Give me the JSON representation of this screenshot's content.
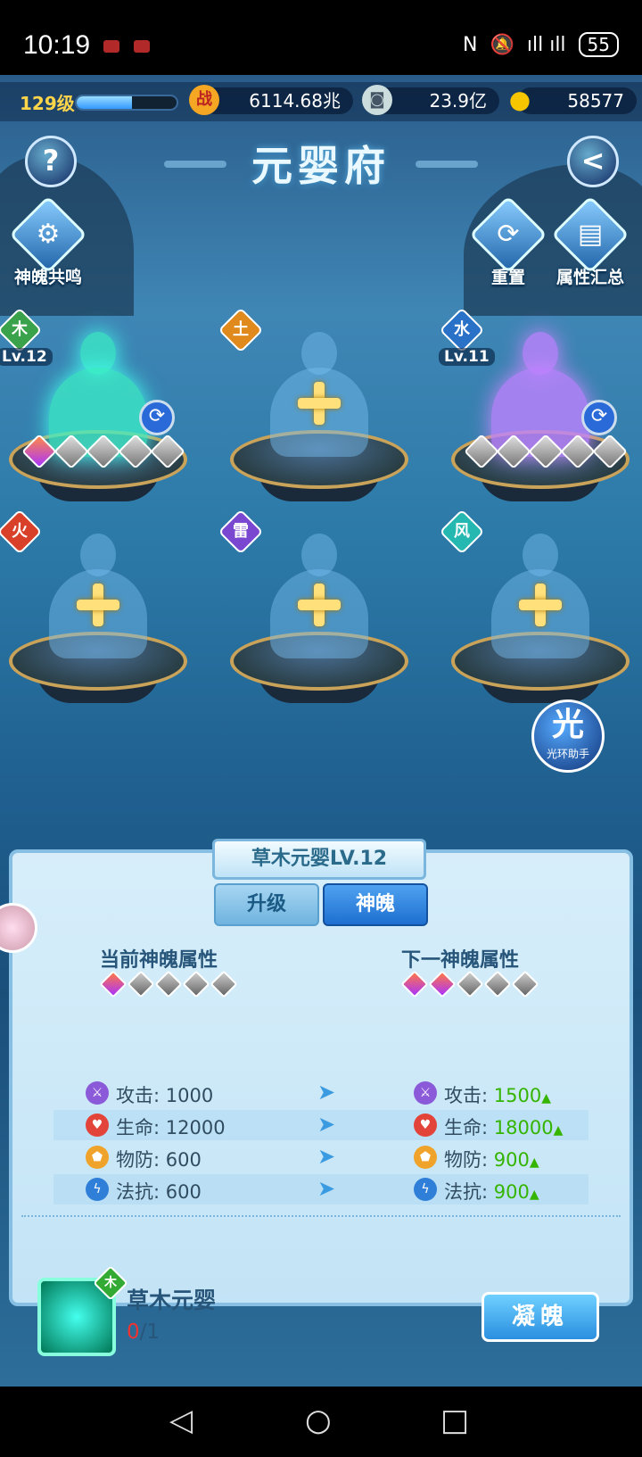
{
  "status": {
    "time": "10:19",
    "signal": "ıll ıll",
    "battery": "55"
  },
  "player": {
    "level": "129级",
    "xp_fraction": 0.55
  },
  "resources": [
    {
      "icon": "战",
      "value": "6114.68兆"
    },
    {
      "icon": "◙",
      "value": "23.9亿"
    },
    {
      "icon": "●",
      "value": "58577"
    }
  ],
  "title": "元婴府",
  "buttons": {
    "help": "?",
    "back": "<",
    "resonance": "神魄共鸣",
    "reset": "重置",
    "summary": "属性汇总"
  },
  "slots": [
    {
      "element": "木",
      "level": "Lv.12",
      "color": "#3aa24a"
    },
    {
      "element": "土",
      "color": "#e08a1e"
    },
    {
      "element": "水",
      "level": "Lv.11",
      "color": "#2a72c8"
    },
    {
      "element": "火",
      "color": "#d8402a"
    },
    {
      "element": "雷",
      "color": "#7a48d0"
    },
    {
      "element": "风",
      "color": "#25b8b0"
    }
  ],
  "assistant": {
    "big": "光",
    "small": "光环助手"
  },
  "panel": {
    "title": "草木元婴LV.12",
    "tabs": [
      "升级",
      "神魄"
    ],
    "current_header": "当前神魄属性",
    "next_header": "下一神魄属性",
    "stats": [
      {
        "name": "攻击: ",
        "current": "1000",
        "next": "1500"
      },
      {
        "name": "生命: ",
        "current": "12000",
        "next": "18000"
      },
      {
        "name": "物防: ",
        "current": "600",
        "next": "900"
      },
      {
        "name": "法抗: ",
        "current": "600",
        "next": "900"
      }
    ],
    "item": {
      "tag": "木",
      "name": "草木元婴",
      "have": "0",
      "need": "/1"
    },
    "condense": "凝魄"
  }
}
